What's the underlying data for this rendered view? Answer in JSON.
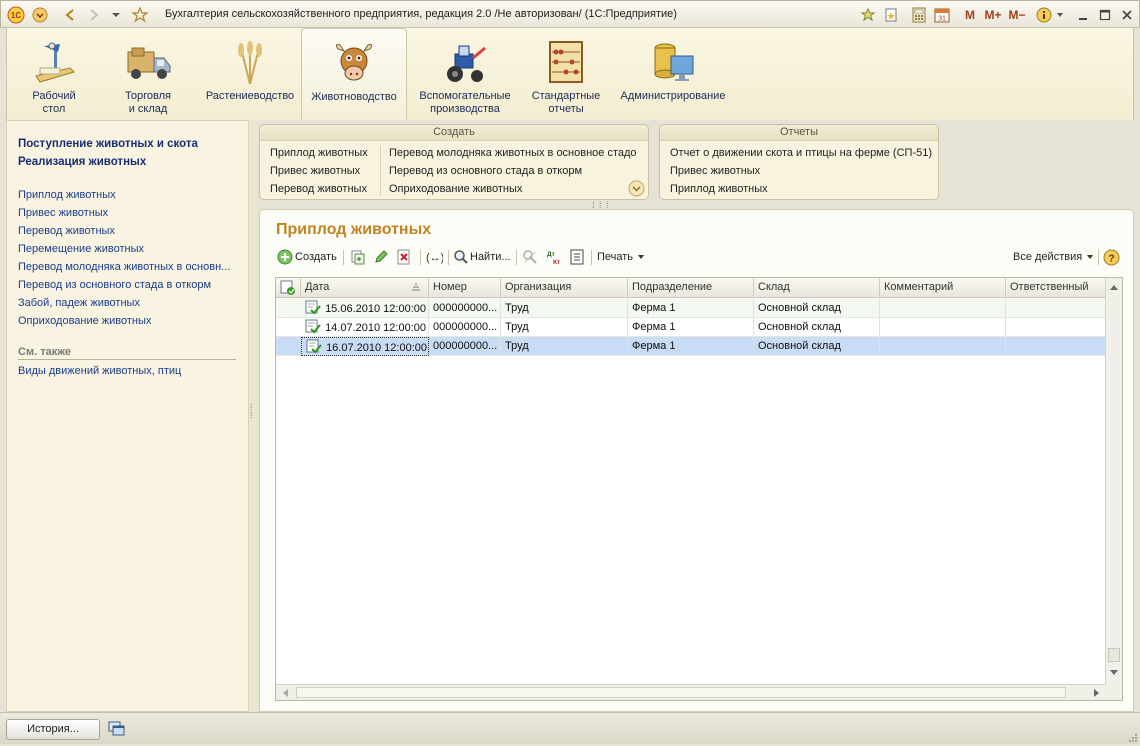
{
  "window": {
    "title": "Бухгалтерия сельскохозяйственного предприятия, редакция 2.0 /Не авторизован/  (1С:Предприятие)",
    "toolbar_text": {
      "m": "M",
      "m_plus": "M+",
      "m_minus": "M−"
    }
  },
  "sections": [
    {
      "label": "Рабочий\nстол",
      "icon": "desk-lamp-icon"
    },
    {
      "label": "Торговля\nи склад",
      "icon": "truck-icon"
    },
    {
      "label": "Растениеводство",
      "icon": "wheat-icon"
    },
    {
      "label": "Животноводство",
      "icon": "cow-icon"
    },
    {
      "label": "Вспомогательные\nпроизводства",
      "icon": "tractor-icon"
    },
    {
      "label": "Стандартные\nотчеты",
      "icon": "abacus-icon"
    },
    {
      "label": "Администрирование",
      "icon": "computer-icon"
    }
  ],
  "left_panel": {
    "main_links": [
      "Поступление животных и скота",
      "Реализация животных"
    ],
    "doc_links": [
      "Приплод животных",
      "Привес животных",
      "Перевод животных",
      "Перемещение животных",
      "Перевод молодняка животных в основн...",
      "Перевод из основного стада в откорм",
      "Забой, падеж животных",
      "Оприходование животных"
    ],
    "see_also_title": "См. также",
    "see_also_links": [
      "Виды движений животных, птиц"
    ]
  },
  "create_box": {
    "title": "Создать",
    "col1": [
      "Приплод животных",
      "Привес животных",
      "Перевод животных"
    ],
    "col2": [
      "Перевод молодняка животных в основное стадо",
      "Перевод из основного стада в откорм",
      "Оприходование животных"
    ]
  },
  "reports_box": {
    "title": "Отчеты",
    "items": [
      "Отчет о движении скота и птицы на ферме (СП-51)",
      "Привес животных",
      "Приплод животных"
    ]
  },
  "document_list": {
    "title": "Приплод животных",
    "toolbar": {
      "create": "Создать",
      "find": "Найти...",
      "print": "Печать",
      "all_actions": "Все действия",
      "dt_kt": "Дт Кт"
    },
    "columns": [
      "Дата",
      "Номер",
      "Организация",
      "Подразделение",
      "Склад",
      "Комментарий",
      "Ответственный"
    ],
    "rows": [
      {
        "date": "15.06.2010 12:00:00",
        "number": "000000000...",
        "org": "Труд",
        "unit": "Ферма 1",
        "warehouse": "Основной склад",
        "comment": "",
        "responsible": ""
      },
      {
        "date": "14.07.2010 12:00:00",
        "number": "000000000...",
        "org": "Труд",
        "unit": "Ферма 1",
        "warehouse": "Основной склад",
        "comment": "",
        "responsible": ""
      },
      {
        "date": "16.07.2010 12:00:00",
        "number": "000000000...",
        "org": "Труд",
        "unit": "Ферма 1",
        "warehouse": "Основной склад",
        "comment": "",
        "responsible": ""
      }
    ]
  },
  "statusbar": {
    "history_button": "История..."
  },
  "colors": {
    "accent_title": "#c2841e",
    "link": "#1b3c8c",
    "selected_row": "#c8dcf5"
  }
}
